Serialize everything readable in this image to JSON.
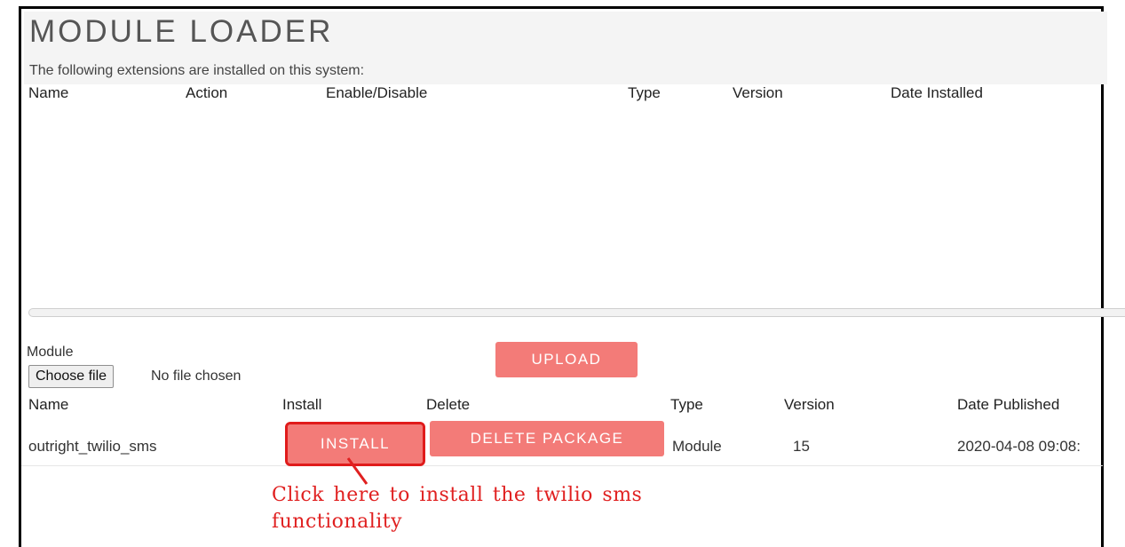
{
  "header": {
    "title": "MODULE LOADER",
    "subtitle": "The following extensions are installed on this system:"
  },
  "extensions_table": {
    "columns": [
      "Name",
      "Action",
      "Enable/Disable",
      "Type",
      "Version",
      "Date Installed"
    ],
    "rows": []
  },
  "upload_section": {
    "module_label": "Module",
    "choose_file_label": "Choose file",
    "no_file_text": "No file chosen",
    "upload_label": "UPLOAD"
  },
  "packages_table": {
    "columns": [
      "Name",
      "Install",
      "Delete",
      "Type",
      "Version",
      "Date Published"
    ],
    "rows": [
      {
        "name": "outright_twilio_sms",
        "install_label": "INSTALL",
        "delete_label": "DELETE PACKAGE",
        "type": "Module",
        "version": "15",
        "date_published": "2020-04-08 09:08:"
      }
    ]
  },
  "annotation": {
    "line1": "Click here to install the twilio sms",
    "line2": "functionality",
    "color": "#e02020"
  },
  "colors": {
    "button": "#f37b78",
    "highlight": "#e01b1b"
  }
}
